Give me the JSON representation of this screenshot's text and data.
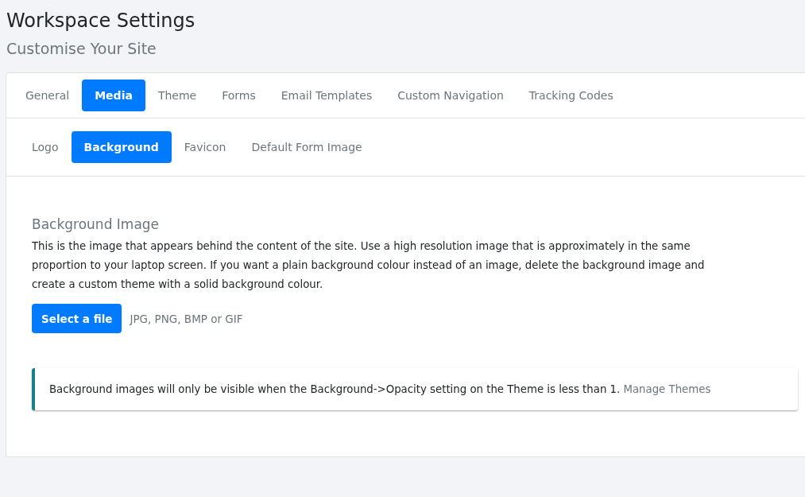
{
  "page": {
    "title": "Workspace Settings",
    "subtitle": "Customise Your Site"
  },
  "tabs": [
    {
      "label": "General",
      "selected": false
    },
    {
      "label": "Media",
      "selected": true
    },
    {
      "label": "Theme",
      "selected": false
    },
    {
      "label": "Forms",
      "selected": false
    },
    {
      "label": "Email Templates",
      "selected": false
    },
    {
      "label": "Custom Navigation",
      "selected": false
    },
    {
      "label": "Tracking Codes",
      "selected": false
    }
  ],
  "subtabs": [
    {
      "label": "Logo",
      "selected": false
    },
    {
      "label": "Background",
      "selected": true
    },
    {
      "label": "Favicon",
      "selected": false
    },
    {
      "label": "Default Form Image",
      "selected": false
    }
  ],
  "section": {
    "heading": "Background Image",
    "description": "This is the image that appears behind the content of the site. Use a high resolution image that is approximately in the same proportion to your laptop screen. If you want a plain background colour instead of an image, delete the background image and create a custom theme with a solid background colour.",
    "button": "Select a file",
    "file_types": "JPG, PNG, BMP or GIF"
  },
  "alert": {
    "text": "Background images will only be visible when the Background->Opacity setting on the Theme is less than 1.",
    "link": "Manage Themes"
  }
}
